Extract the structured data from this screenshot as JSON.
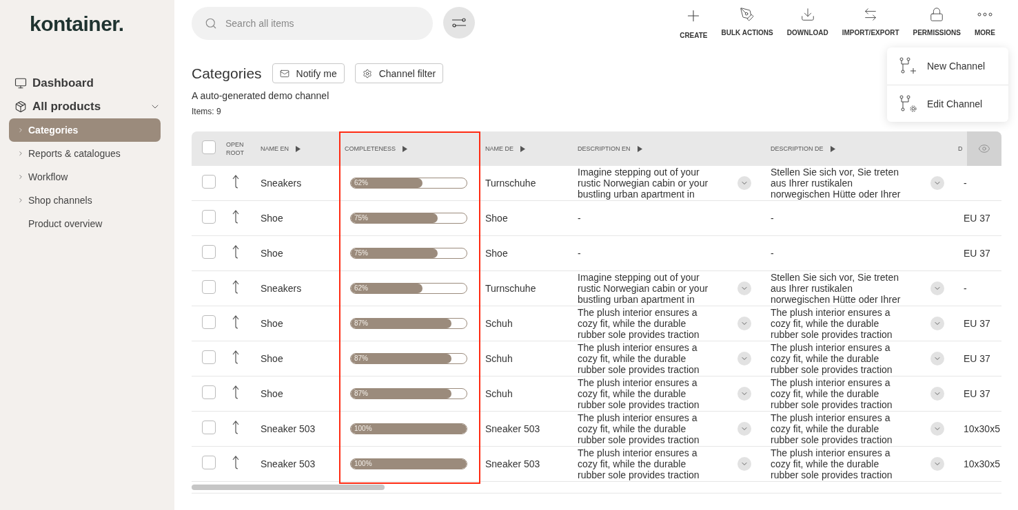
{
  "logo": "kontainer.",
  "sidebar": {
    "items": [
      {
        "label": "Dashboard"
      },
      {
        "label": "All products",
        "expanded": true,
        "children": [
          {
            "label": "Categories",
            "selected": true,
            "expandable": true
          },
          {
            "label": "Reports & catalogues",
            "selected": false,
            "expandable": true
          },
          {
            "label": "Workflow",
            "selected": false,
            "expandable": true
          },
          {
            "label": "Shop channels",
            "selected": false,
            "expandable": true
          },
          {
            "label": "Product overview",
            "selected": false,
            "expandable": false
          }
        ]
      }
    ]
  },
  "search": {
    "placeholder": "Search all items"
  },
  "toolbar": [
    "CREATE",
    "BULK ACTIONS",
    "DOWNLOAD",
    "IMPORT/EXPORT",
    "PERMISSIONS",
    "MORE"
  ],
  "more_menu": {
    "open": true,
    "items": [
      "New Channel",
      "Edit Channel"
    ]
  },
  "page": {
    "title": "Categories",
    "buttons": [
      "Notify me",
      "Channel filter"
    ],
    "subtitle": "A auto-generated demo channel",
    "count": "Items: 9"
  },
  "table": {
    "all_checked": false,
    "columns": [
      {
        "label": "OPEN ROOT",
        "sortable": false
      },
      {
        "label": "NAME EN",
        "sortable": true
      },
      {
        "label": "COMPLETENESS",
        "sortable": true,
        "highlighted": true
      },
      {
        "label": "NAME DE",
        "sortable": true
      },
      {
        "label": "DESCRIPTION EN",
        "sortable": true
      },
      {
        "label": "DESCRIPTION DE",
        "sortable": true
      },
      {
        "label": "D",
        "sortable": false
      }
    ],
    "rows": [
      {
        "checked": false,
        "name_en": "Sneakers",
        "completeness": {
          "reading": "62%",
          "level": 0.62
        },
        "name_de": "Turnschuhe",
        "description_en": {
          "text": "Imagine stepping out of your rustic Norwegian cabin or your bustling urban apartment in",
          "expandable": true
        },
        "description_de": {
          "text": "Stellen Sie sich vor, Sie treten aus Ihrer rustikalen norwegischen Hütte oder Ihrer",
          "expandable": true
        },
        "column_9": "-"
      },
      {
        "checked": false,
        "name_en": "Shoe",
        "completeness": {
          "reading": "75%",
          "level": 0.75
        },
        "name_de": "Shoe",
        "description_en": {
          "text": "-",
          "expandable": false
        },
        "description_de": {
          "text": "-",
          "expandable": false
        },
        "column_9": "EU 37"
      },
      {
        "checked": false,
        "name_en": "Shoe",
        "completeness": {
          "reading": "75%",
          "level": 0.75
        },
        "name_de": "Shoe",
        "description_en": {
          "text": "-",
          "expandable": false
        },
        "description_de": {
          "text": "-",
          "expandable": false
        },
        "column_9": "EU 37"
      },
      {
        "checked": false,
        "name_en": "Sneakers",
        "completeness": {
          "reading": "62%",
          "level": 0.62
        },
        "name_de": "Turnschuhe",
        "description_en": {
          "text": "Imagine stepping out of your rustic Norwegian cabin or your bustling urban apartment in",
          "expandable": true
        },
        "description_de": {
          "text": "Stellen Sie sich vor, Sie treten aus Ihrer rustikalen norwegischen Hütte oder Ihrer",
          "expandable": true
        },
        "column_9": "-"
      },
      {
        "checked": false,
        "name_en": "Shoe",
        "completeness": {
          "reading": "87%",
          "level": 0.87
        },
        "name_de": "Schuh",
        "description_en": {
          "text": "The plush interior ensures a cozy fit, while the durable rubber sole provides traction",
          "expandable": true
        },
        "description_de": {
          "text": "The plush interior ensures a cozy fit, while the durable rubber sole provides traction",
          "expandable": true
        },
        "column_9": "EU 37"
      },
      {
        "checked": false,
        "name_en": "Shoe",
        "completeness": {
          "reading": "87%",
          "level": 0.87
        },
        "name_de": "Schuh",
        "description_en": {
          "text": "The plush interior ensures a cozy fit, while the durable rubber sole provides traction",
          "expandable": true
        },
        "description_de": {
          "text": "The plush interior ensures a cozy fit, while the durable rubber sole provides traction",
          "expandable": true
        },
        "column_9": "EU 37"
      },
      {
        "checked": false,
        "name_en": "Shoe",
        "completeness": {
          "reading": "87%",
          "level": 0.87
        },
        "name_de": "Schuh",
        "description_en": {
          "text": "The plush interior ensures a cozy fit, while the durable rubber sole provides traction",
          "expandable": true
        },
        "description_de": {
          "text": "The plush interior ensures a cozy fit, while the durable rubber sole provides traction",
          "expandable": true
        },
        "column_9": "EU 37"
      },
      {
        "checked": false,
        "name_en": "Sneaker 503",
        "completeness": {
          "reading": "100%",
          "level": 1
        },
        "name_de": "Sneaker 503",
        "description_en": {
          "text": "The plush interior ensures a cozy fit, while the durable rubber sole provides traction",
          "expandable": true
        },
        "description_de": {
          "text": "The plush interior ensures a cozy fit, while the durable rubber sole provides traction",
          "expandable": true
        },
        "column_9": "10x30x5"
      },
      {
        "checked": false,
        "name_en": "Sneaker 503",
        "completeness": {
          "reading": "100%",
          "level": 1
        },
        "name_de": "Sneaker 503",
        "description_en": {
          "text": "The plush interior ensures a cozy fit, while the durable rubber sole provides traction",
          "expandable": true
        },
        "description_de": {
          "text": "The plush interior ensures a cozy fit, while the durable rubber sole provides traction",
          "expandable": true
        },
        "column_9": "10x30x5"
      }
    ]
  }
}
